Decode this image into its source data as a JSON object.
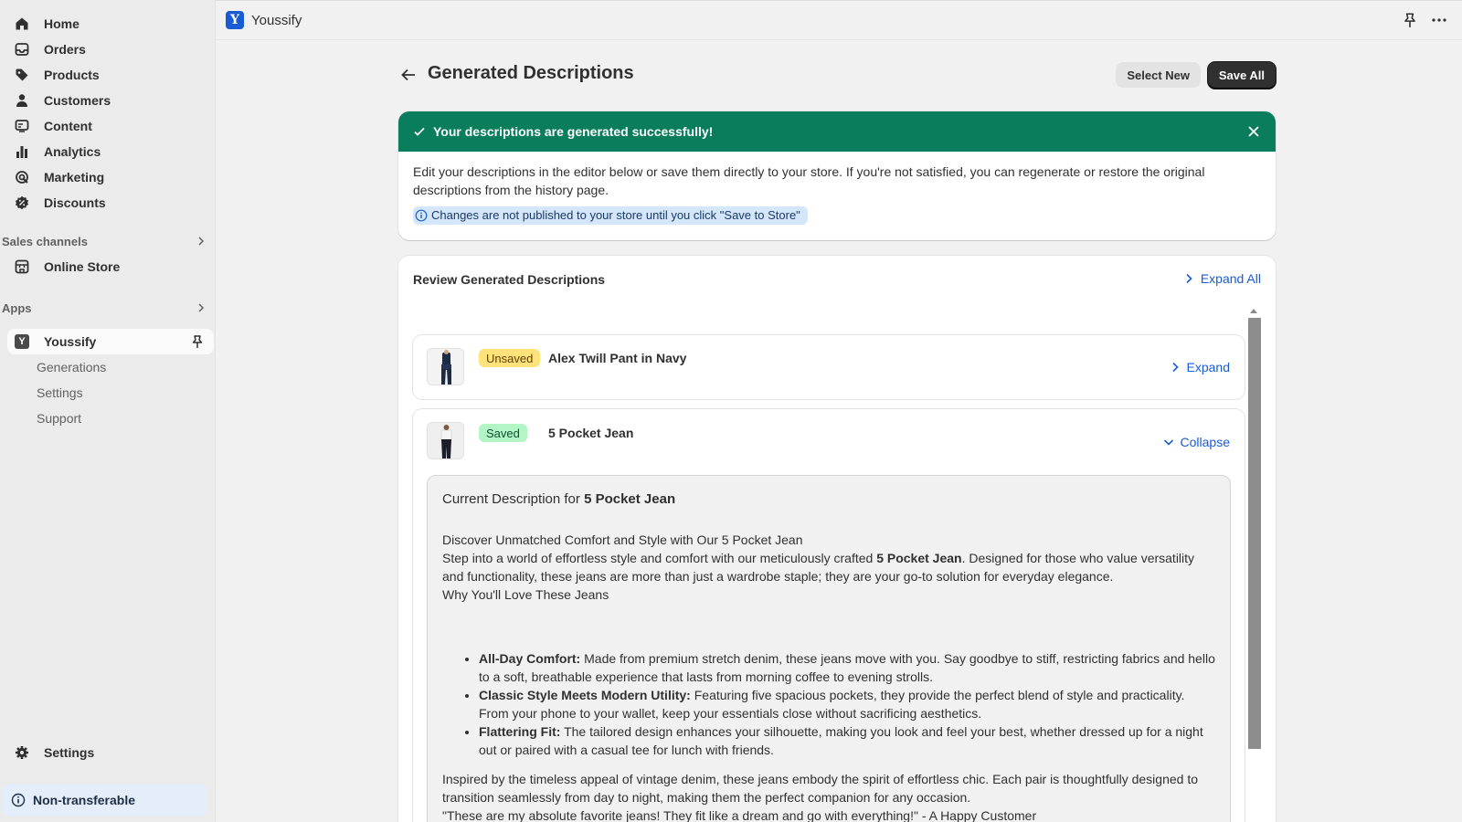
{
  "sidebar": {
    "items": [
      {
        "label": "Home",
        "icon": "home-icon"
      },
      {
        "label": "Orders",
        "icon": "inbox-icon"
      },
      {
        "label": "Products",
        "icon": "tag-icon"
      },
      {
        "label": "Customers",
        "icon": "person-icon"
      },
      {
        "label": "Content",
        "icon": "content-icon"
      },
      {
        "label": "Analytics",
        "icon": "bar-chart-icon"
      },
      {
        "label": "Marketing",
        "icon": "target-icon"
      },
      {
        "label": "Discounts",
        "icon": "discount-icon"
      }
    ],
    "sales_channels_label": "Sales channels",
    "online_store_label": "Online Store",
    "apps_label": "Apps",
    "app_name": "Youssify",
    "app_sub_items": [
      "Generations",
      "Settings",
      "Support"
    ],
    "settings_label": "Settings",
    "non_transferable_label": "Non-transferable"
  },
  "topbar": {
    "logo_letter": "Y",
    "app_title": "Youssify"
  },
  "page": {
    "title": "Generated Descriptions",
    "select_new_label": "Select New",
    "save_all_label": "Save All"
  },
  "banner": {
    "title": "Your descriptions are generated successfully!",
    "body": "Edit your descriptions in the editor below or save them directly to your store. If you're not satisfied, you can regenerate or restore the original descriptions from the history page.",
    "note": "Changes are not published to your store until you click \"Save to Store\"",
    "color": "#0a7d5c"
  },
  "review": {
    "title": "Review Generated Descriptions",
    "expand_all_label": "Expand All",
    "products": [
      {
        "status": "Unsaved",
        "name": "Alex Twill Pant in Navy",
        "action": "Expand"
      },
      {
        "status": "Saved",
        "name": "5 Pocket Jean",
        "action": "Collapse"
      }
    ],
    "description": {
      "heading_prefix": "Current Description for ",
      "heading_product": "5 Pocket Jean",
      "intro_title": "Discover Unmatched Comfort and Style with Our 5 Pocket Jean",
      "intro_pre": "Step into a world of effortless style and comfort with our meticulously crafted ",
      "intro_bold": "5 Pocket Jean",
      "intro_post": ". Designed for those who value versatility and functionality, these jeans are more than just a wardrobe staple; they are your go-to solution for everyday elegance.",
      "why_title": "Why You'll Love These Jeans",
      "bullets": [
        {
          "bold": "All-Day Comfort:",
          "text": " Made from premium stretch denim, these jeans move with you. Say goodbye to stiff, restricting fabrics and hello to a soft, breathable experience that lasts from morning coffee to evening strolls."
        },
        {
          "bold": "Classic Style Meets Modern Utility:",
          "text": " Featuring five spacious pockets, they provide the perfect blend of style and practicality. From your phone to your wallet, keep your essentials close without sacrificing aesthetics."
        },
        {
          "bold": "Flattering Fit:",
          "text": " The tailored design enhances your silhouette, making you look and feel your best, whether dressed up for a night out or paired with a casual tee for lunch with friends."
        }
      ],
      "closing": "Inspired by the timeless appeal of vintage denim, these jeans embody the spirit of effortless chic. Each pair is thoughtfully designed to transition seamlessly from day to night, making them the perfect companion for any occasion.",
      "quote": "\"These are my absolute favorite jeans! They fit like a dream and go with everything!\" - A Happy Customer"
    }
  }
}
